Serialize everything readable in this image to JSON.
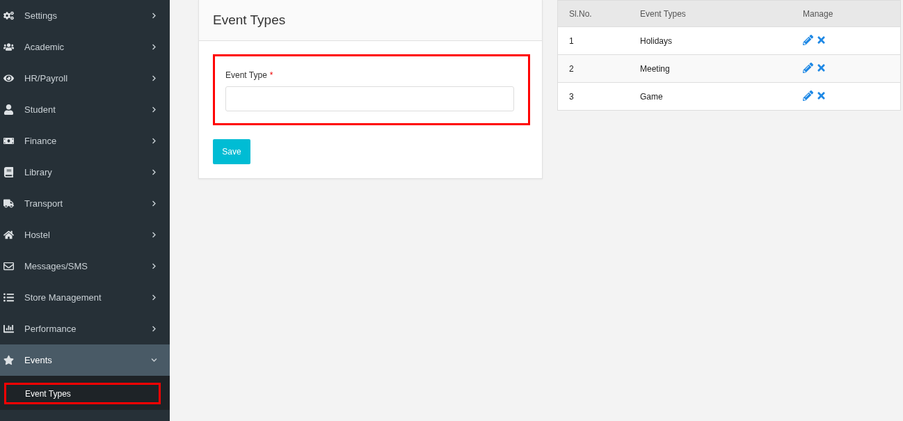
{
  "sidebar": {
    "items": [
      {
        "label": "Settings",
        "expanded": false,
        "selected": false
      },
      {
        "label": "Academic",
        "expanded": false,
        "selected": false
      },
      {
        "label": "HR/Payroll",
        "expanded": false,
        "selected": false
      },
      {
        "label": "Student",
        "expanded": false,
        "selected": false
      },
      {
        "label": "Finance",
        "expanded": false,
        "selected": false
      },
      {
        "label": "Library",
        "expanded": false,
        "selected": false
      },
      {
        "label": "Transport",
        "expanded": false,
        "selected": false
      },
      {
        "label": "Hostel",
        "expanded": false,
        "selected": false
      },
      {
        "label": "Messages/SMS",
        "expanded": false,
        "selected": false
      },
      {
        "label": "Store Management",
        "expanded": false,
        "selected": false
      },
      {
        "label": "Performance",
        "expanded": false,
        "selected": false
      },
      {
        "label": "Events",
        "expanded": true,
        "selected": true,
        "children": [
          {
            "label": "Event Types",
            "selected": true,
            "highlighted": true
          }
        ]
      }
    ]
  },
  "form": {
    "title": "Event Types",
    "field": {
      "label": "Event Type",
      "required": "*",
      "highlighted": true
    },
    "button": "Save"
  },
  "table": {
    "columns": [
      "Sl.No.",
      "Event Types",
      "Manage"
    ],
    "rows": [
      {
        "cells": [
          "1",
          "Holidays"
        ]
      },
      {
        "cells": [
          "2",
          "Meeting"
        ]
      },
      {
        "cells": [
          "3",
          "Game"
        ]
      }
    ]
  }
}
